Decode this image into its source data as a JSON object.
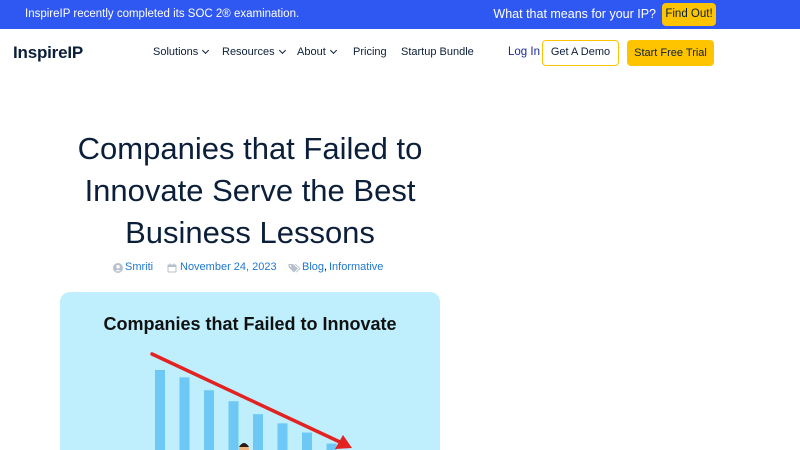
{
  "announcement": {
    "message": "InspireIP recently completed its SOC 2® examination.",
    "question": "What that means for your IP?",
    "cta_label": "Find Out!"
  },
  "nav": {
    "logo": "InspireIP",
    "items": [
      {
        "label": "Solutions",
        "has_dropdown": true
      },
      {
        "label": "Resources",
        "has_dropdown": true
      },
      {
        "label": "About",
        "has_dropdown": true
      },
      {
        "label": "Pricing",
        "has_dropdown": false
      },
      {
        "label": "Startup Bundle",
        "has_dropdown": false
      }
    ],
    "login_label": "Log In",
    "demo_label": "Get A Demo",
    "trial_label": "Start Free Trial"
  },
  "article": {
    "title_lines": [
      "Companies that Failed to",
      "Innovate Serve the Best",
      "Business Lessons"
    ],
    "author": "Smriti",
    "date": "November 24, 2023",
    "categories": [
      "Blog",
      "Informative"
    ],
    "category_separator": ", "
  },
  "featured_image": {
    "title": "Companies that Failed to Innovate",
    "relative_bar_heights": [
      1.0,
      0.92,
      0.78,
      0.66,
      0.52,
      0.42,
      0.32,
      0.2
    ],
    "colors": {
      "background": "#bfeefc",
      "bars": "#6ec8f5",
      "arrow": "#e32222"
    }
  },
  "colors": {
    "announcement_bg": "#2f57f2",
    "accent_yellow": "#ffc400",
    "text_dark": "#0b1f3a",
    "meta_blue": "#1f77d0"
  }
}
